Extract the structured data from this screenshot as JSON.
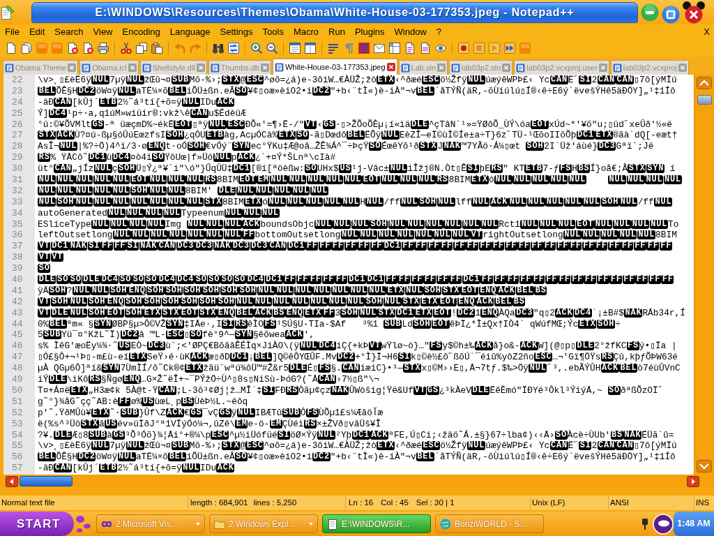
{
  "window": {
    "title": "E:\\WINDOWS\\Resources\\Themes\\Obama\\White-House-03-177353.jpeg - Notepad++"
  },
  "menu": {
    "items": [
      "File",
      "Edit",
      "Search",
      "View",
      "Encoding",
      "Language",
      "Settings",
      "Tools",
      "Macro",
      "Run",
      "Plugins",
      "Window",
      "?"
    ],
    "close": "X"
  },
  "tabs": [
    {
      "label": "Obama Theme",
      "selected": false
    },
    {
      "label": "Obama.icl",
      "selected": false
    },
    {
      "label": "Shellstyle.dll",
      "selected": false
    },
    {
      "label": "Thumbs.db",
      "selected": false
    },
    {
      "label": "White-House-03-177353.jpeg",
      "selected": true
    },
    {
      "label": "Lab.sln",
      "selected": false
    },
    {
      "label": "lab03p2.sln",
      "selected": false
    },
    {
      "label": "lab03p2.vcxproj.user",
      "selected": false
    },
    {
      "label": "lab03p2.vcxproj",
      "selected": false
    }
  ],
  "editor": {
    "lines": [
      {
        "number": "22",
        "text": "\\v>¸▯£èË6ÿ**NUL**7µÿ**NUL**žŒû¬¤**SUB**Mõ-%›;**STX**@**ESC**^øõ=¿á)e-3ôiW…€ÀÜŽ;žò**ETX**‹^ðæé**ESC**ö½Žfÿ**NUL**úæýêWPÞ£‹ Yc**CAN**Ë˝**SI**2**CAN****CAN**▯7ô[ýMÏú"
      },
      {
        "number": "23",
        "text": "**BEL**ÕÊ§H**DC2**öW¤ÿ**NUL**aTË¼×õ**BEL**iÕÜ±ßn.eÂ**SO**¥¢▯oæ»èiO2•i**DC2**\"+b‹¨tÌ«)è-iÀ\"¬v**BEL**´åTÝÑ(äR,-õÙiúlú▯Í®‹ê÷E6ý`ëvešÝHê5äÐÖY]„¹‡1Íô"
      },
      {
        "number": "24",
        "text": "-äÐ**CAN**[kÛj´**ETB**2½˜á³tí{+õ=ÿ**NUL**IDu**ACK**"
      },
      {
        "number": "25",
        "text": "Ý]**DC4**¹p÷·a,q1úM»wiüir®:vkž\\ê**CAN**u$ÉdèüÆ"
      },
      {
        "number": "26",
        "text": "°ú:©¥ÕVMlt**GS**-ª üæçmD%~ékË**EOT**▯ªÿ**NUL****ESC**ÐÕ«'=¶›Ë-/\"**VT**‹**GS**·▯>ŽÕoÕÈµ¡í«ìä**DLE**^çTâN`¹»=ŸØôÕ_ÙÝ\\óa**EOT**xÚd~*'¥õ\"u;▯üd˝xeÛð'½«ë"
      },
      {
        "number": "27",
        "text": "**STX****ACK**Ù?¤ú-ßµ§óÛúEœzfsI**SOH**¿qÓU**ETB**àg,AcµÓCà%**ETX****SO**-ã▯Dœdô**BEL**ËÕÿ**NUL**EèZÎ—eÏ©ùÌ©Íe±a÷T}6z˝TÜ-¹ŒõoIIõÕþ**DC1****ETX**®ãà`dQ[-eæt†"
      },
      {
        "number": "28",
        "text": "AsÎ¬**NUL**|%?÷Ö)4^i/3·ø**ENQ**t·oÓ**SOH**€vÓý¨**SYN**ec°ŸKu‡Æ@oâ…ŽÊ¾Á^¯÷ÞçŸ**SO**ÉœêYô¹ð**STX**J**NAK**™7YÃö·Á¼▯œt **SOH**2I`Üž'áùé}**DC3**Gªï´;Jë"
      },
      {
        "number": "29",
        "text": "**RS**% ŸÅCô˜**DC1**ù**DC4**¤ò4i**SO**ŸôUœ|f»Üó**NUL**p**ACK**¿`+¤Ý*ŠLnª\\cIà#"
      },
      {
        "number": "30",
        "text": "üt°**CAN**„jÍz**NUL**ç**SOH**Ü▯Ý¿ª¥`i\"\\ó\"}ŰqÛÜ‡**DC1**[®í[ªöèßw:**SO**UHx$**US**¹j-Vâc±**NUL**iÎžj®N.Òt▯Ê**SI**þE**RS**\" KT**ETB**7-ƒ**FS**H**BS**Í}oå€;Â**STX****SYN** í"
      },
      {
        "number": "31",
        "text": "**NUL****NUL****NUL****NUL****NUL****EOT****NUL****NUL****NUL****RS**8BIM**EOT****EM****NUL****NUL****NUL****NUL****NUL****EOT****NUL****NUL****NUL****RS**8BIM**ETX**ó**NUL****NUL****NUL****NUL****NUL**    **NUL****NUL****NUL****NUL**"
      },
      {
        "number": "32",
        "text": "**NUL****NUL****NUL****NUL****NUL****SOH****NUL****NUL**8BIM' **DLE****NUL****NUL****NUL****NUL****NUL**"
      },
      {
        "number": "33",
        "text": "**NUL****SOH****NUL****NUL****NUL****NUL****NUL****NUL****NUL****STX**8BIM**ETX**ó**NUL****NUL****NUL****NUL****NUL**H**NUL**/ff**NUL****SOH****NUL**lff**NUL****ACK****NUL****NUL****NUL****NUL****NUL****SOH****NUL**/ff**NUL**"
      },
      {
        "number": "34",
        "text": "autoGenerated**NUL****NUL****NUL****NUL**Typeenum**NUL****NUL****NUL**"
      },
      {
        "number": "35",
        "text": "ESliceType**NUL****NUL****NUL****NUL**Img **NUL****NUL****NUL****ACK**boundsObjc**NUL****NUL****NUL****SOH****NUL****NUL****NUL****NUL****NUL****NUL**Rct1**NUL****NUL****NUL****EOT****NUL****NUL****NUL****NUL**To"
      },
      {
        "number": "36",
        "text": "leftOutsetlong**NUL****NUL****NUL****NUL****NUL****NUL****NUL****FF**bottomOutsetlong**NUL****NUL****NUL****NUL****NUL****NUL****NUL****VT**rightOutsetlong**NUL****NUL****NUL****NUL****NUL**8BIM"
      },
      {
        "number": "37",
        "text": "**VT****DC1****NAK****SI****FF****FF****SI****NAK****CAN****DC3****DC3****NAK****DC3****DC3****CAN****DC1****FF****FF****FF****FF****FF****FF****DC1****FF****FF****FF****FF****FF****FF****FF****FF****FF****FF****FF****FF****FF****FF****FF****FF****FF****FF****FF****FF****FF**"
      },
      {
        "number": "38",
        "text": "**VT****VT**"
      },
      {
        "number": "39",
        "text": "**SO**"
      },
      {
        "number": "40",
        "text": "**DLE****SO****SO****DLE****DC4****SO****SO****SO****DC4****DC4****SO****SO****SO****SO****DC4****DC1****FF****FF****FF****FF****FF****DC1****DC1****FF****FF****FF****FF****FF****FF****DC1****FF****FF****FF****FF****FF****FF****FF****FF****FF****FF****FF****FF****FF****FF****FF**"
      },
      {
        "number": "41",
        "text": "ÿÄ**SOH**?**NUL****NUL****SOH****ENQ****SOH****SOH****SOH****SOH****SOH****SOH****NUL****NUL****NUL****NUL****NUL****NUL****NUL****ETX****NUL****SOH****STX****EOT****ENQ****ACK****BEL****BS**"
      },
      {
        "number": "42",
        "text": "**VT****SOH****NUL****SOH****ENQ****SOH****SOH****SOH****SOH****SOH****SOH****NUL****NUL****NUL****NUL****NUL****NUL****NUL****SOH****NUL****STX****ETX****EOT****ENQ****ACK****BEL****BS**"
      },
      {
        "number": "43",
        "text": "**VT****DLE****NUL****SOH****EOT****SOH****ETX****STX****EOT****STX****ENQ****BEL****ACK****BS****ENQ****ETX****FF**3**SOH****NUL****STX****DC1****ETX****EOT**!**DC2**1**ENQ**ÀQa**DC3**\"q▯2**ACK****DC4**`¡±B#$**NAK**RÅb34r,Í"
      },
      {
        "number": "44",
        "text": "0%**BEL**ªm« §**SYN**ØBP§µ>Ô©VŽ**SYN**‡IÅe·,I**SI****RS**êÌO**FS**¹SÚ§U-TIa-$Af   ³%1 **SUB**Ld**SOH****EOT**êÞÏ¿*Ì±Qx†IÒ4` qWúfMŒ;Ýc**ETX****SOH**÷"
      },
      {
        "number": "45",
        "text": "5**SUB**Yü¯¤°KžL˜Ï)**DC2**â ™L-**ESC**▯**SO**fè°9^—**SYN**§êõwea**ACK**′,"
      },
      {
        "number": "46",
        "text": "s% ÌêG′æoËy¼¾·˜**US**EÒ~**DC3**ù¨;<′ØPÇ€BõãâÊÉÌq×JiÀO\\(ÿ**NUL****DC4**iÇ{+kÞ**VT**wŸlø~ò}…\"**FS**y$©h±‰**ACK**å}o&-**ACK**W](@▯p▯**DLE**2°žfKC**FS**ý•▯Ïa |"
      },
      {
        "number": "47",
        "text": "▯Ó£§Ô+¬¹Þ▯-m£ù-eí**ETX**SeŸ›é·ùK**ACK**æ▯ðD**DC1**¡**BEL**]Q©êÔYŒÛF.Mv**DC2**+°Ì}Ï¬H6**SI**k▯©è½£ô˝ßõÚ`¯éiû%yôZ2ño**ESC**…¬′Gï¶ÖŸs**RS**Çû,kþƒÕÞW63é"
      },
      {
        "number": "48",
        "text": "µÀ QGµ6Ô]ªí&**SYN**7ÙmÌÍ/ô˜Ck®¢**ETX**žãü¨wªú¾ôÜ™#Ž&r5**DLE**É▯**FS**§.**CAN**iæiC}•³—**STX**x▯©M››E▯,Å¬7tƒ.$‰>Öÿ**NUL**˝³,.ebÃÝÛH**ACK****BEL**ò7éùÛVnC"
      },
      {
        "number": "49",
        "text": "iÝ**DLE**\\iKô**RS**§Ñgø**ENQ**…G×Ž˜ëÎ+~¯PÝžÖ÷Ù^▯8s▯NiSù-ÞóG?(˜Å**CAN**›7½▯ß\"\\¬"
      },
      {
        "number": "50",
        "text": "T¤+Á¤ë**ETX**„H3æ¢k 5À@t-Ÿ**CAN**;L-3õ³¢Øj¦ž…MÎ´‡**SI**FÐ**RS**Òãµ¢çz**NAK**ÛWòšig¦Ÿë&Uf**VT****GS**¿³kÀeV**DLE**ËêÈmó\"ÏÐYé³Ôkl³ÝiýÅ,~ **SO**ðªßÕzOÏ˝"
      },
      {
        "number": "51",
        "text": "g˜°}¾åG˜çç˜AB:è**FF**ø%**US**ùœL¸p**BS**ÙèÞ½L.~ëôq"
      },
      {
        "number": "52",
        "text": "p'˜.ŸðMÛù¥**ETX**˜·**SUB**}Ûf\\Z**ACK**€**GS**¯vÇ**GS**ÿ**NUL**IBÆTû**SUB**Ô**FS**ÙÕµ1£s¼Æâöآæ"
      },
      {
        "number": "53",
        "text": "ë(%s^³Üö**STX**ã**US**év»üÏðJ°ª1VÏýÓó¼¬,ûZê\\**EM**e-ö-**EM**ÇÙéi**RS**×±ŽVð▯vâÜš¥Î"
      },
      {
        "number": "54",
        "text": "?¥.**DLE**Æ▯8**SUB**à**GS**³Õ³Óõ}¾¦Åi°+®¼\\p**ESC**^µ½iÜófüé**SI**öØ×Ýÿ**NUL**²Yþ**DC1****ACK**ªFE,Ú▯Ci;‹žäö˜Á.±§}67÷lba¢)‹‹Å›**SO**Àcè÷ÙUb′**BS****NAK**ËÜã´û="
      },
      {
        "number": "55",
        "text": "\\v>¸▯£èË6ÿ**NUL**7µÿ**NUL**žŒû¬¤**SUB**Mõ-%›;**STX**@**ESC**^øõ=¿á)e-3ôiW…€ÀÜŽ;žò**ETX**‹^ðæé**ESC**ö½Žfÿ**NUL**úæýêWPÞ£‹ Yc**CAN**Ë˝**SI**2**CAN****CAN**▯7ô[ýMÏú"
      },
      {
        "number": "56",
        "text": "**BEL**ÕÊ§H**DC2**öW¤ÿ**NUL**aTË¼×õ**BEL**iÕÜ±ßn.eÂ**SO**¥¢▯oæ»èiO2•i**DC2**\"+b‹¨tÌ«)è-iÀ\"¬v**BEL**´åTÝÑ(äR,-õÙiúlú▯Í®‹ê÷E6ý`ëvešÝHê5äÐÖY]„¹‡1Íô"
      },
      {
        "number": "57",
        "text": "-äÐ**CAN**[kÛj´**ETB**2½˜á³tí{+õ=ÿ**NUL**IDu**ACK**"
      }
    ]
  },
  "status_bar": {
    "file_type": "Normal text file",
    "length": "length : 684,901",
    "lines": "lines : 5,250",
    "line": "Ln : 16",
    "column": "Col : 45",
    "selection": "Sel : 30 | 1",
    "line_endings": "Unix (LF)",
    "encoding": "ANSI",
    "insert_mode": "INS"
  },
  "taskbar": {
    "start": "START",
    "tasks": [
      {
        "label": "2 Microsoft Vis...",
        "selected": false,
        "grouped": true
      },
      {
        "label": "2 Windows Expl...",
        "selected": false,
        "grouped": true
      },
      {
        "label": "E:\\WINDOWS\\R...",
        "selected": true,
        "grouped": false
      },
      {
        "label": "BonziWORLD - S...",
        "selected": false,
        "grouped": false
      }
    ],
    "clock": "1:48 AM"
  }
}
